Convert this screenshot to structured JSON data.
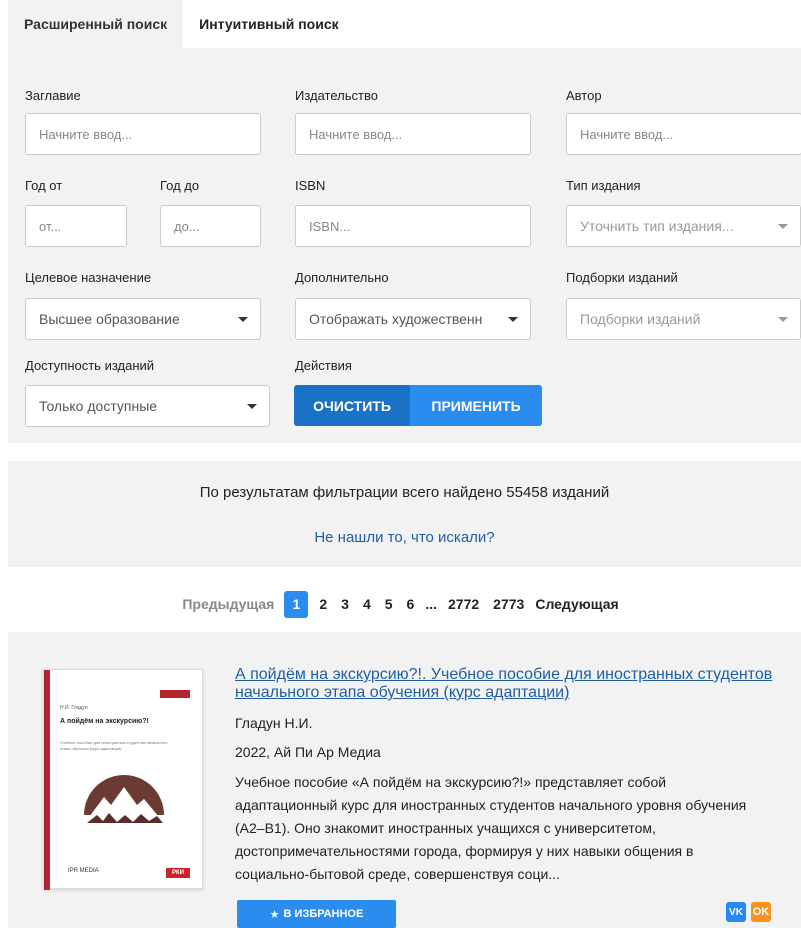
{
  "tabs": [
    {
      "label": "Расширенный поиск",
      "active": true
    },
    {
      "label": "Интуитивный поиск",
      "active": false
    }
  ],
  "filters": {
    "title": {
      "label": "Заглавие",
      "placeholder": "Начните ввод..."
    },
    "publisher": {
      "label": "Издательство",
      "placeholder": "Начните ввод..."
    },
    "author": {
      "label": "Автор",
      "placeholder": "Начните ввод..."
    },
    "year_from": {
      "label": "Год от",
      "placeholder": "от..."
    },
    "year_to": {
      "label": "Год до",
      "placeholder": "до..."
    },
    "isbn": {
      "label": "ISBN",
      "placeholder": "ISBN..."
    },
    "edition_type": {
      "label": "Тип издания",
      "placeholder": "Уточнить тип издания..."
    },
    "purpose": {
      "label": "Целевое назначение",
      "value": "Высшее образование"
    },
    "extra": {
      "label": "Дополнительно",
      "value": "Отображать художественн"
    },
    "collections": {
      "label": "Подборки изданий",
      "placeholder": "Подборки изданий"
    },
    "availability": {
      "label": "Доступность изданий",
      "value": "Только доступные"
    },
    "actions": {
      "label": "Действия",
      "clear": "ОЧИСТИТЬ",
      "apply": "ПРИМЕНИТЬ"
    }
  },
  "results": {
    "count_text": "По результатам фильтрации всего найдено 55458 изданий",
    "not_found_link": "Не нашли то, что искали?"
  },
  "pagination": {
    "prev": "Предыдущая",
    "pages": [
      "1",
      "2",
      "3",
      "4",
      "5",
      "6"
    ],
    "current": "1",
    "ellipsis": "...",
    "last_pages": [
      "2772",
      "2773"
    ],
    "next": "Следующая"
  },
  "book": {
    "title": "А пойдём на экскурсию?!. Учебное пособие для иностранных студентов начального этапа обучения (курс адаптации)",
    "author": "Гладун Н.И.",
    "year_publisher": "2022, Ай Пи Ар Медиа",
    "description": "Учебное пособие «А пойдём на экскурсию?!» представляет собой адаптационный курс для иностранных студентов начального уровня обучения (А2–В1). Оно знакомит иностранных учащихся с университетом, достопримечательностями города, формируя у них навыки общения в социально-бытовой среде, совершенствуя соци...",
    "favorite_button": "В ИЗБРАННОЕ",
    "cover": {
      "author": "Н.И. Гладун",
      "title": "А пойдём на экскурсию?!",
      "subtitle": "Учебное пособие для иностранных студентов начального этапа обучения (курс адаптации)",
      "publisher_logo": "IPR MEDIA",
      "badge": "РКИ"
    },
    "social": {
      "vk": "VK",
      "ok": "OK"
    }
  },
  "colors": {
    "accent": "#2a8cef",
    "accent_dark": "#1a72c7",
    "link": "#1f5ea5",
    "panel_bg": "#f2f2f2"
  }
}
